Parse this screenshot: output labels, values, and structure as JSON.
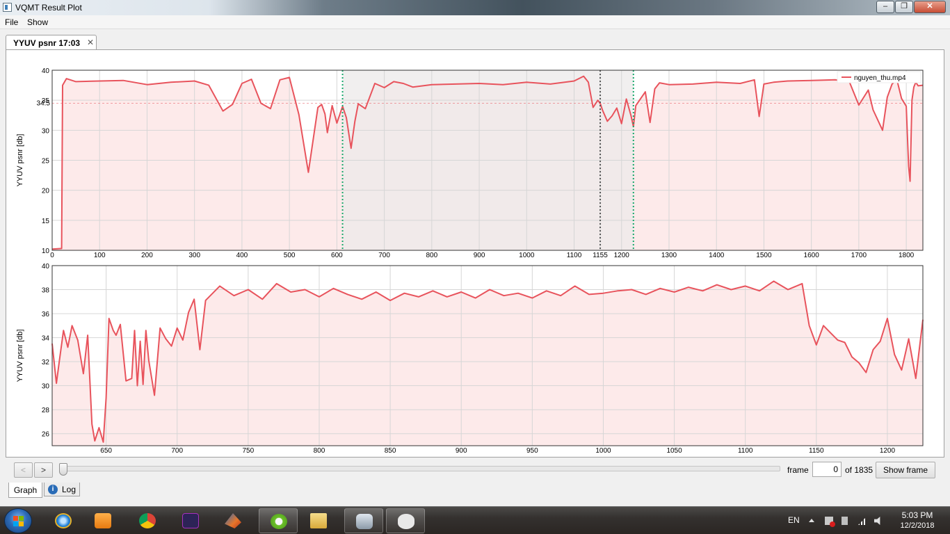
{
  "window": {
    "title": "VQMT Result Plot",
    "controls": {
      "minimize": "‒",
      "maximize": "❐",
      "close": "✕"
    }
  },
  "menu": {
    "file": "File",
    "show": "Show"
  },
  "tab": {
    "label": "YYUV psnr 17:03",
    "close": "✕"
  },
  "colors": {
    "series": "#e8535c",
    "fill": "#fdeaea",
    "selection": "#eceaea",
    "selection_top": "#e6f6fa",
    "marker_green": "#17a86b",
    "marker_gray": "#555555"
  },
  "chart_data": [
    {
      "type": "line",
      "name": "overview",
      "ylabel": "YYUV psnr [db]",
      "xlim": [
        0,
        1835
      ],
      "ylim": [
        10,
        40
      ],
      "xticks": [
        "0",
        "100",
        "200",
        "300",
        "400",
        "500",
        "600",
        "700",
        "800",
        "900",
        "1000",
        "1100",
        "1155",
        "1200",
        "1300",
        "1400",
        "1500",
        "1600",
        "1700",
        "1800"
      ],
      "yticks": [
        "10",
        "15",
        "20",
        "25",
        "30",
        "35",
        "40"
      ],
      "legend": {
        "label": "nguyen_thu.mp4",
        "position": "top-right"
      },
      "selection_range": [
        612,
        1225
      ],
      "marker_x": 1155,
      "hline_label": "34.5",
      "hline_value": 34.5,
      "series": [
        {
          "name": "nguyen_thu.mp4",
          "x": [
            0,
            20,
            22,
            30,
            50,
            100,
            150,
            200,
            250,
            300,
            330,
            360,
            380,
            400,
            420,
            440,
            460,
            480,
            500,
            520,
            540,
            560,
            568,
            575,
            580,
            590,
            600,
            612,
            620,
            630,
            638,
            645,
            660,
            680,
            700,
            720,
            740,
            760,
            800,
            850,
            900,
            950,
            1000,
            1050,
            1100,
            1120,
            1130,
            1140,
            1150,
            1155,
            1160,
            1170,
            1180,
            1190,
            1200,
            1210,
            1220,
            1225,
            1230,
            1250,
            1260,
            1270,
            1280,
            1300,
            1350,
            1400,
            1450,
            1480,
            1490,
            1500,
            1520,
            1550,
            1600,
            1650,
            1680,
            1700,
            1720,
            1730,
            1750,
            1760,
            1770,
            1780,
            1790,
            1800,
            1805,
            1808,
            1812,
            1816,
            1820,
            1825,
            1835
          ],
          "y": [
            10.2,
            10.3,
            37.5,
            38.6,
            38.1,
            38.2,
            38.3,
            37.6,
            38.0,
            38.2,
            37.5,
            33.2,
            34.3,
            37.8,
            38.5,
            34.5,
            33.6,
            38.4,
            38.8,
            32.6,
            23.0,
            33.8,
            34.3,
            32.7,
            29.6,
            34.1,
            31.2,
            34.0,
            32.1,
            27.0,
            31.5,
            34.4,
            33.6,
            37.8,
            37.1,
            38.1,
            37.8,
            37.2,
            37.6,
            37.7,
            37.8,
            37.6,
            38.0,
            37.7,
            38.2,
            39.0,
            38.0,
            33.8,
            35.0,
            34.5,
            33.3,
            31.5,
            32.4,
            33.7,
            31.1,
            35.2,
            32.4,
            30.6,
            34.1,
            36.4,
            31.3,
            36.9,
            37.9,
            37.6,
            37.7,
            38.0,
            37.8,
            38.4,
            32.3,
            37.7,
            38.0,
            38.2,
            38.3,
            38.4,
            38.1,
            34.2,
            36.7,
            33.4,
            30.0,
            35.5,
            37.7,
            38.5,
            35.3,
            34.0,
            24.0,
            21.5,
            35.0,
            37.2,
            38.0,
            37.4,
            37.5
          ]
        }
      ]
    },
    {
      "type": "line",
      "name": "zoom",
      "ylabel": "YYUV psnr [db]",
      "xlim": [
        612,
        1225
      ],
      "ylim": [
        25,
        40
      ],
      "xticks": [
        "650",
        "700",
        "750",
        "800",
        "850",
        "900",
        "950",
        "1000",
        "1050",
        "1100",
        "1150",
        "1200"
      ],
      "yticks": [
        "26",
        "28",
        "30",
        "32",
        "34",
        "36",
        "38",
        "40"
      ],
      "series": [
        {
          "name": "nguyen_thu.mp4",
          "x": [
            612,
            615,
            617,
            620,
            623,
            626,
            630,
            634,
            637,
            640,
            642,
            645,
            648,
            650,
            652,
            655,
            657,
            660,
            664,
            668,
            670,
            672,
            674,
            676,
            678,
            680,
            684,
            688,
            692,
            696,
            700,
            704,
            708,
            712,
            716,
            720,
            730,
            740,
            750,
            760,
            770,
            780,
            790,
            800,
            810,
            820,
            830,
            840,
            850,
            860,
            870,
            880,
            890,
            900,
            910,
            920,
            930,
            940,
            950,
            960,
            970,
            980,
            990,
            1000,
            1010,
            1020,
            1030,
            1040,
            1050,
            1060,
            1070,
            1080,
            1090,
            1100,
            1110,
            1120,
            1130,
            1140,
            1145,
            1150,
            1155,
            1160,
            1165,
            1170,
            1175,
            1180,
            1185,
            1190,
            1195,
            1200,
            1205,
            1210,
            1215,
            1220,
            1225
          ],
          "y": [
            33.5,
            30.2,
            32.0,
            34.6,
            33.2,
            35.0,
            33.8,
            31.0,
            34.2,
            26.8,
            25.4,
            26.5,
            25.3,
            29.0,
            35.6,
            34.6,
            34.2,
            35.1,
            30.4,
            30.6,
            34.6,
            30.0,
            33.7,
            30.1,
            34.6,
            32.1,
            29.2,
            34.8,
            33.9,
            33.3,
            34.8,
            33.8,
            36.1,
            37.2,
            33.0,
            37.1,
            38.3,
            37.5,
            38.0,
            37.2,
            38.5,
            37.8,
            38.0,
            37.4,
            38.1,
            37.6,
            37.2,
            37.8,
            37.1,
            37.7,
            37.4,
            37.9,
            37.4,
            37.8,
            37.3,
            38.0,
            37.5,
            37.7,
            37.3,
            37.9,
            37.5,
            38.3,
            37.6,
            37.7,
            37.9,
            38.0,
            37.6,
            38.1,
            37.8,
            38.2,
            37.9,
            38.4,
            38.0,
            38.3,
            37.9,
            38.7,
            38.0,
            38.5,
            35.0,
            33.4,
            35.0,
            34.4,
            33.8,
            33.6,
            32.4,
            31.9,
            31.1,
            33.0,
            33.7,
            35.6,
            32.6,
            31.3,
            33.9,
            30.6,
            35.5
          ]
        }
      ]
    }
  ],
  "controls": {
    "prev": "<",
    "next": ">",
    "frame_label": "frame",
    "frame_value": "0",
    "frame_total": "of 1835",
    "show_frame": "Show frame"
  },
  "bottom_tabs": {
    "graph": "Graph",
    "log": "Log",
    "log_icon": "i"
  },
  "taskbar": {
    "apps": [
      "internet-explorer-icon",
      "media-player-icon",
      "chrome-icon",
      "scope-app-icon",
      "matlab-icon",
      "vqmt-icon",
      "file-explorer-icon",
      "camera-app-icon",
      "eye-viewer-icon"
    ],
    "language": "EN",
    "time": "5:03 PM",
    "date": "12/2/2018"
  }
}
